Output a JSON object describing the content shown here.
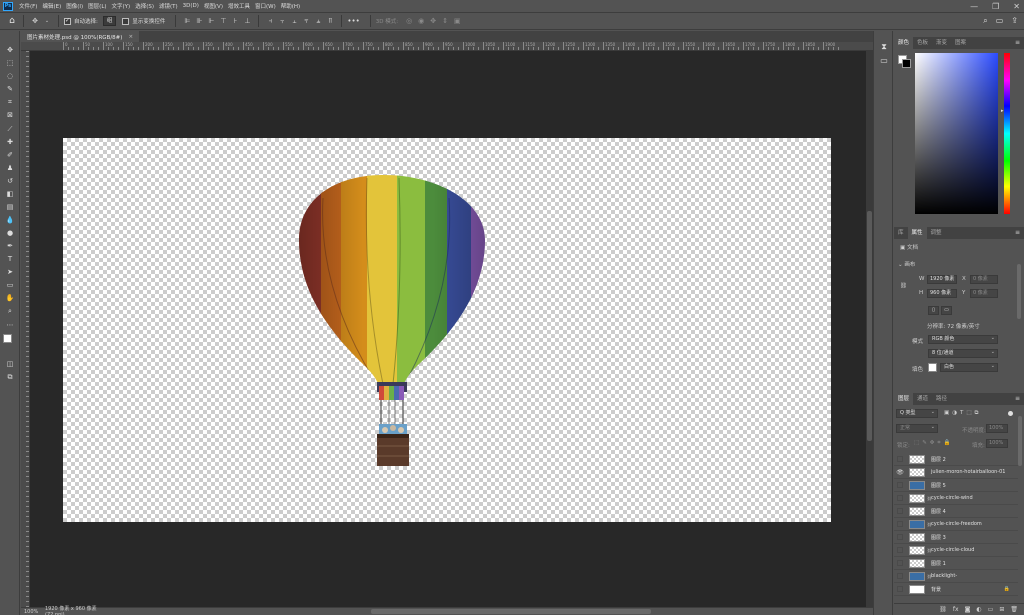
{
  "menubar": {
    "logo": "Ps",
    "items": [
      "文件(F)",
      "编辑(E)",
      "图像(I)",
      "图层(L)",
      "文字(Y)",
      "选择(S)",
      "滤镜(T)",
      "3D(D)",
      "视图(V)",
      "增效工具",
      "窗口(W)",
      "帮助(H)"
    ],
    "window_controls": {
      "minimize": "—",
      "restore": "❐",
      "close": "✕"
    }
  },
  "options": {
    "auto_select_label": "自动选择:",
    "auto_select_value": "组",
    "transform_label": "显示变换控件",
    "mode_3d_label": "3D 模式:",
    "more": "•••"
  },
  "document": {
    "tab_title": "图片素材处理.psd @ 100%(RGB/8#)",
    "close": "×"
  },
  "ruler": {
    "h_labels": [
      "0",
      "50",
      "100",
      "150",
      "200",
      "250",
      "300",
      "350",
      "400",
      "450",
      "500",
      "550",
      "600",
      "650",
      "700",
      "750",
      "800",
      "850",
      "900",
      "950",
      "1000",
      "1050",
      "1100",
      "1150",
      "1200",
      "1250",
      "1300",
      "1350",
      "1400",
      "1450",
      "1500",
      "1550",
      "1600",
      "1650",
      "1700",
      "1750",
      "1800",
      "1850",
      "1900"
    ]
  },
  "status": {
    "zoom": "100%",
    "doc_info": "1920 像素 x 960 像素 (72 ppi)"
  },
  "color_panel": {
    "tabs": [
      "颜色",
      "色板",
      "渐变",
      "图案"
    ],
    "active_tab": 0,
    "hue": "#2b4bff"
  },
  "properties_panel": {
    "tabs": [
      "库",
      "属性",
      "调整"
    ],
    "active_tab": 1,
    "doc_label": "文档",
    "section": "画布",
    "w_label": "W",
    "w_value": "1920 像素",
    "h_label": "H",
    "h_value": "960 像素",
    "x_label": "X",
    "x_placeholder": "0 像素",
    "y_label": "Y",
    "y_placeholder": "0 像素",
    "resolution": "分辨率: 72 像素/英寸",
    "mode_label": "模式",
    "mode_value": "RGB 颜色",
    "depth_value": "8 位/通道",
    "fill_label": "填色",
    "fill_value": "白色"
  },
  "layers_panel": {
    "tabs": [
      "图层",
      "通道",
      "路径"
    ],
    "active_tab": 0,
    "filter_kind": "Q 类型",
    "blend_mode": "正常",
    "opacity_label": "不透明度:",
    "opacity_value": "100%",
    "lock_label": "锁定:",
    "fill_label": "填充:",
    "fill_value": "100%",
    "layers": [
      {
        "name": "图层 2",
        "visible": false,
        "thumb": "checker",
        "linked": false
      },
      {
        "name": "julien-moron-hotairballoon-01",
        "visible": true,
        "thumb": "checker",
        "linked": false
      },
      {
        "name": "图层 5",
        "visible": false,
        "thumb": "blue",
        "linked": false
      },
      {
        "name": "cycle-circle-wind",
        "visible": false,
        "thumb": "checker",
        "linked": true
      },
      {
        "name": "图层 4",
        "visible": false,
        "thumb": "checker",
        "linked": false
      },
      {
        "name": "cycle-circle-freedom",
        "visible": false,
        "thumb": "blue",
        "linked": true
      },
      {
        "name": "图层 3",
        "visible": false,
        "thumb": "checker",
        "linked": false
      },
      {
        "name": "cycle-circle-cloud",
        "visible": false,
        "thumb": "checker",
        "linked": true
      },
      {
        "name": "图层 1",
        "visible": false,
        "thumb": "checker",
        "linked": false
      },
      {
        "name": "blacklight-",
        "visible": false,
        "thumb": "blue",
        "linked": true
      },
      {
        "name": "背景",
        "visible": false,
        "thumb": "solid",
        "linked": false,
        "locked": true
      }
    ],
    "footer_icons": [
      "link-icon",
      "fx-icon",
      "mask-icon",
      "adjustment-icon",
      "group-icon",
      "new-layer-icon",
      "delete-icon"
    ]
  }
}
